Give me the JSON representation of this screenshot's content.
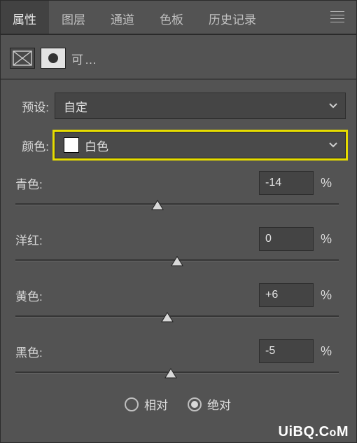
{
  "tabs": {
    "items": [
      "属性",
      "图层",
      "通道",
      "色板",
      "历史记录"
    ],
    "activeIndex": 0
  },
  "adjustment": {
    "truncated": "可…"
  },
  "preset": {
    "label": "预设:",
    "value": "自定"
  },
  "colorRow": {
    "label": "颜色:",
    "value": "白色",
    "swatch": "#ffffff"
  },
  "sliders": [
    {
      "label": "青色:",
      "value": "-14",
      "pct": "%",
      "pos": 44
    },
    {
      "label": "洋红:",
      "value": "0",
      "pct": "%",
      "pos": 50
    },
    {
      "label": "黄色:",
      "value": "+6",
      "pct": "%",
      "pos": 47
    },
    {
      "label": "黑色:",
      "value": "-5",
      "pct": "%",
      "pos": 48
    }
  ],
  "method": {
    "relative": "相对",
    "absolute": "绝对",
    "selected": "absolute"
  },
  "watermark": "UiBQ.CoM"
}
